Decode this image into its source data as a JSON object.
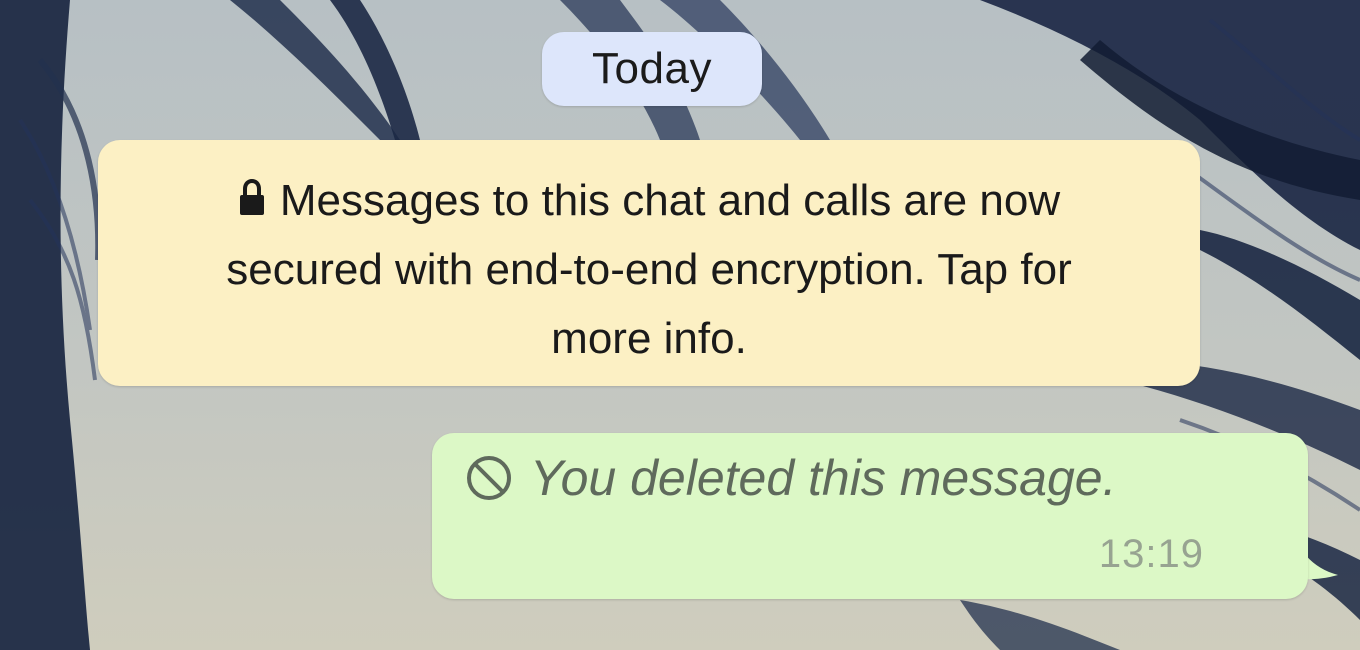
{
  "chat": {
    "date_label": "Today",
    "system_notice": {
      "line1": "Messages to this chat and calls are now",
      "line2": "secured with end-to-end encryption. Tap for",
      "line3": "more info.",
      "icon": "lock-icon"
    },
    "outgoing_message": {
      "text": "You deleted this message.",
      "time": "13:19",
      "icon": "deleted-icon"
    }
  },
  "colors": {
    "date_pill_bg": "#dde6fb",
    "notice_bg": "#fcf0c4",
    "outgoing_bubble_bg": "#dcf8c6",
    "deleted_text": "#5f6a5c",
    "timestamp": "#97a391"
  }
}
